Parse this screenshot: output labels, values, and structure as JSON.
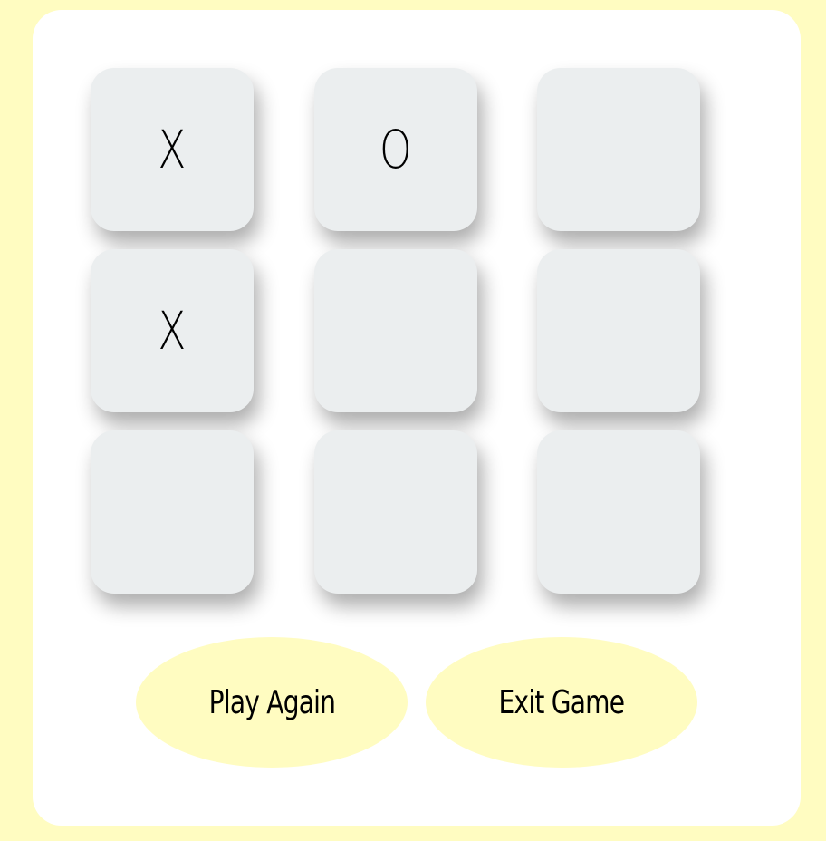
{
  "board": {
    "cells": [
      "X",
      "O",
      "",
      "X",
      "",
      "",
      "",
      "",
      ""
    ]
  },
  "buttons": {
    "play_again": "Play Again",
    "exit_game": "Exit Game"
  },
  "colors": {
    "background": "#fffcc1",
    "panel": "#ffffff",
    "cell": "#ebeeef",
    "button": "#fffcc1",
    "mark": "#000000"
  }
}
